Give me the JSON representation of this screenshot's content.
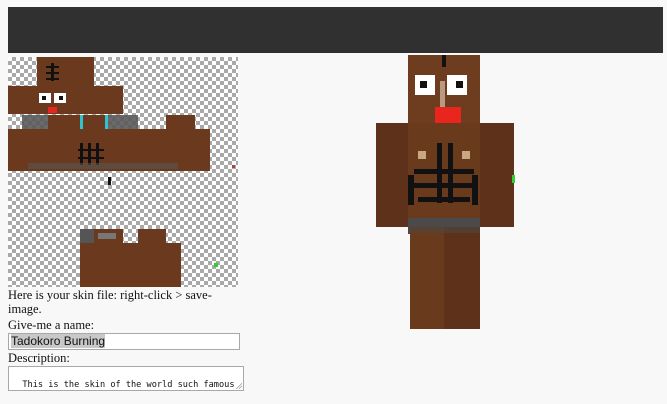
{
  "skin_note": "Here is your skin file: right-click > save-image.",
  "name_label": "Give-me a name:",
  "name_value": "Tadokoro Burning",
  "description_label": "Description:",
  "description_value": "This is the skin of the world such famous \" Tadokoro Burning \" .",
  "colors": {
    "topbar": "#303030",
    "skin_brown": "#6b3a1e",
    "eye_white": "#ffffff",
    "mouth_red": "#e8261e",
    "shorts_gray": "#5a5a5a",
    "accent_cyan": "#2bc4d0"
  },
  "icons": {
    "resize": "resize-grip-icon"
  }
}
